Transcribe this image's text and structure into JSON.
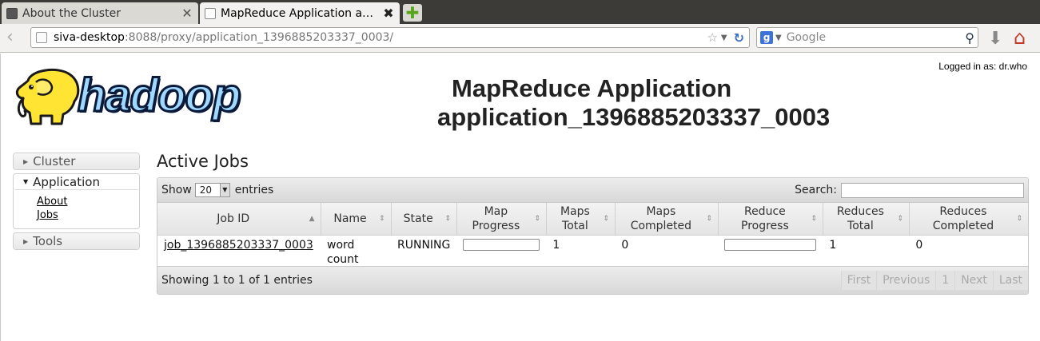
{
  "browser": {
    "tabs": [
      {
        "title": "About the Cluster",
        "active": false
      },
      {
        "title": "MapReduce Application ap…",
        "active": true
      }
    ],
    "url_host": "siva-desktop",
    "url_rest": ":8088/proxy/application_1396885203337_0003/",
    "search_placeholder": "Google"
  },
  "header": {
    "logged_in": "Logged in as: dr.who",
    "logo_text": "hadoop",
    "title_line1": "MapReduce Application",
    "title_line2": "application_1396885203337_0003"
  },
  "nav": {
    "cluster": "Cluster",
    "application": "Application",
    "application_links": [
      "About",
      "Jobs"
    ],
    "tools": "Tools"
  },
  "main": {
    "title": "Active Jobs",
    "show_label": "Show",
    "page_length": "20",
    "entries_label": "entries",
    "search_label": "Search:",
    "columns": [
      "Job ID",
      "Name",
      "State",
      "Map Progress",
      "Maps Total",
      "Maps Completed",
      "Reduce Progress",
      "Reduces Total",
      "Reduces Completed"
    ],
    "rows": [
      {
        "job_id": "job_1396885203337_0003",
        "name": "word count",
        "state": "RUNNING",
        "map_progress": 0,
        "maps_total": "1",
        "maps_completed": "0",
        "reduce_progress": 0,
        "reduces_total": "1",
        "reduces_completed": "0"
      }
    ],
    "info": "Showing 1 to 1 of 1 entries",
    "paginate": {
      "first": "First",
      "previous": "Previous",
      "page": "1",
      "next": "Next",
      "last": "Last"
    }
  },
  "colors": {
    "chrome_dark": "#3c3b37",
    "logo_blue": "#9fd9ff",
    "logo_yellow": "#ffe433"
  }
}
